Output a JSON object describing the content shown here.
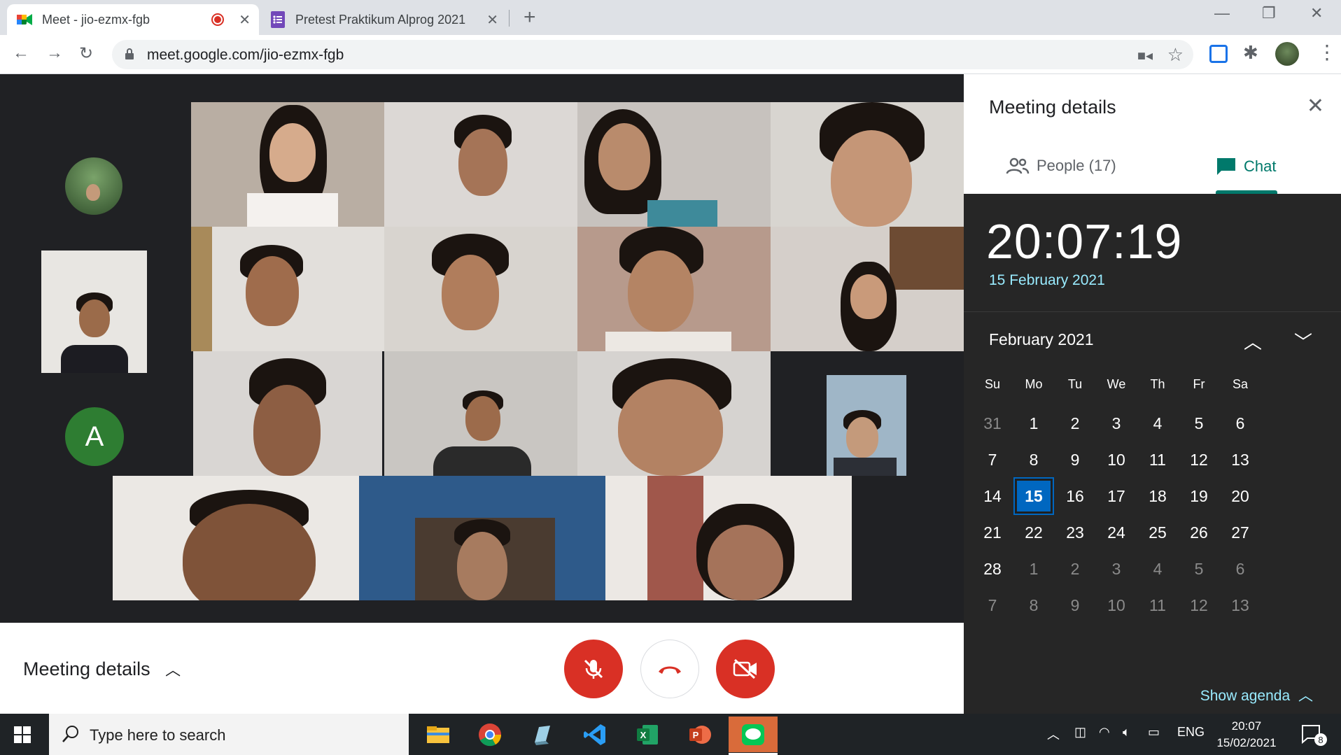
{
  "browser": {
    "tabs": [
      {
        "title": "Meet - jio-ezmx-fgb",
        "active": true,
        "recording": true
      },
      {
        "title": "Pretest Praktikum Alprog 2021",
        "active": false
      }
    ],
    "url": "meet.google.com/jio-ezmx-fgb"
  },
  "meeting": {
    "details_label": "Meeting details",
    "participant_initial": "A",
    "avatar_color": "#2e7d32"
  },
  "panel": {
    "title": "Meeting details",
    "people_tab": "People (17)",
    "chat_tab": "Chat",
    "accent": "#00796b"
  },
  "flyout": {
    "time": "20:07:19",
    "date": "15 February 2021",
    "month_label": "February 2021",
    "weekdays": [
      "Su",
      "Mo",
      "Tu",
      "We",
      "Th",
      "Fr",
      "Sa"
    ],
    "weeks": [
      [
        {
          "d": "31",
          "dim": true
        },
        {
          "d": "1"
        },
        {
          "d": "2"
        },
        {
          "d": "3"
        },
        {
          "d": "4"
        },
        {
          "d": "5"
        },
        {
          "d": "6"
        }
      ],
      [
        {
          "d": "7"
        },
        {
          "d": "8"
        },
        {
          "d": "9"
        },
        {
          "d": "10"
        },
        {
          "d": "11"
        },
        {
          "d": "12"
        },
        {
          "d": "13"
        }
      ],
      [
        {
          "d": "14"
        },
        {
          "d": "15",
          "today": true
        },
        {
          "d": "16"
        },
        {
          "d": "17"
        },
        {
          "d": "18"
        },
        {
          "d": "19"
        },
        {
          "d": "20"
        }
      ],
      [
        {
          "d": "21"
        },
        {
          "d": "22"
        },
        {
          "d": "23"
        },
        {
          "d": "24"
        },
        {
          "d": "25"
        },
        {
          "d": "26"
        },
        {
          "d": "27"
        }
      ],
      [
        {
          "d": "28"
        },
        {
          "d": "1",
          "dim": true
        },
        {
          "d": "2",
          "dim": true
        },
        {
          "d": "3",
          "dim": true
        },
        {
          "d": "4",
          "dim": true
        },
        {
          "d": "5",
          "dim": true
        },
        {
          "d": "6",
          "dim": true
        }
      ],
      [
        {
          "d": "7",
          "dim": true
        },
        {
          "d": "8",
          "dim": true
        },
        {
          "d": "9",
          "dim": true
        },
        {
          "d": "10",
          "dim": true
        },
        {
          "d": "11",
          "dim": true
        },
        {
          "d": "12",
          "dim": true
        },
        {
          "d": "13",
          "dim": true
        }
      ]
    ],
    "show_agenda": "Show agenda",
    "accent": "#0067c0"
  },
  "taskbar": {
    "search_placeholder": "Type here to search",
    "language": "ENG",
    "time": "20:07",
    "date": "15/02/2021",
    "notification_count": "8"
  }
}
